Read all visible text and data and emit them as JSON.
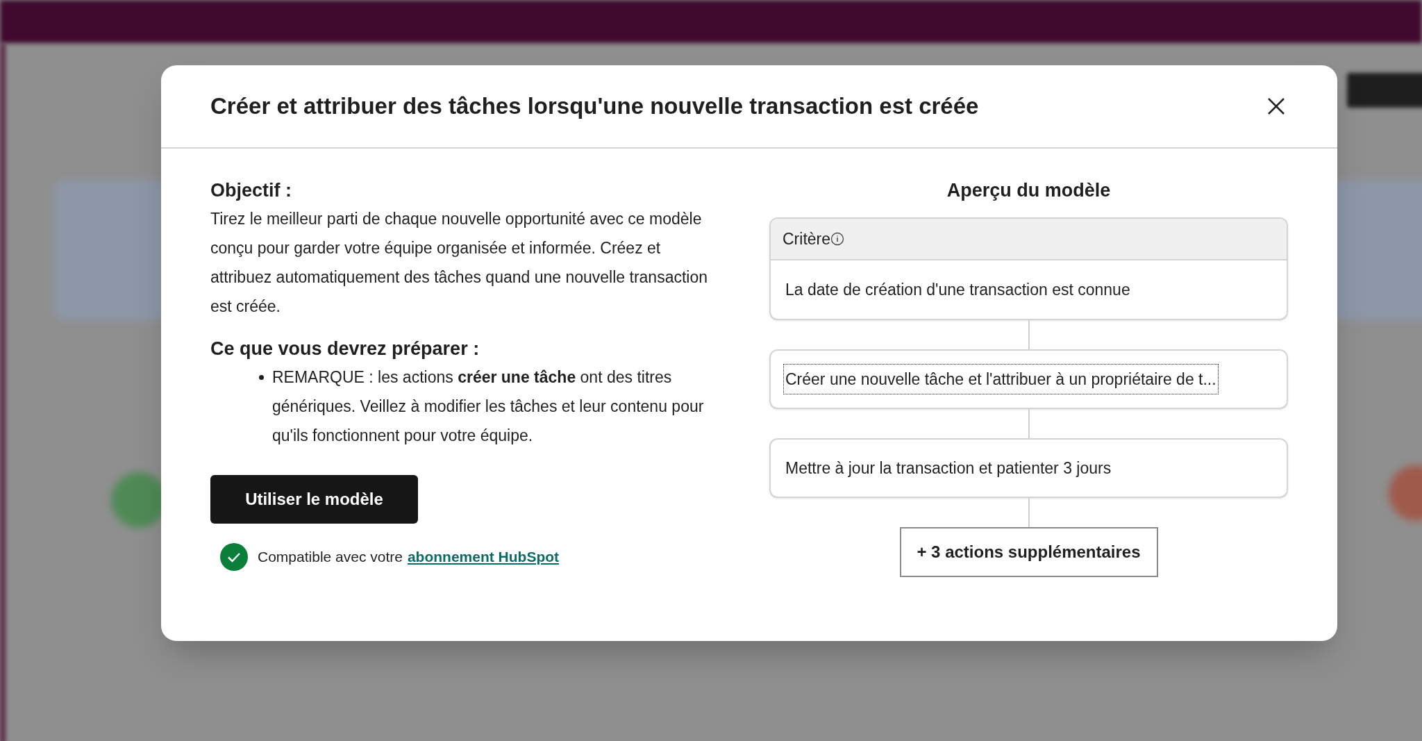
{
  "dialog": {
    "title": "Créer et attribuer des tâches lorsqu'une nouvelle transaction est créée",
    "objective": {
      "heading": "Objectif :",
      "text": "Tirez le meilleur parti de chaque nouvelle opportunité avec ce modèle conçu pour garder votre équipe organisée et informée. Créez et attribuez automatiquement des tâches quand une nouvelle transaction est créée."
    },
    "preparation": {
      "heading": "Ce que vous devrez préparer :",
      "bullets": [
        "REMARQUE : les actions **créer une tâche** ont des titres génériques. Veillez à modifier les tâches et leur contenu pour qu'ils fonctionnent pour votre équipe."
      ]
    },
    "primary_button": "Utiliser le modèle",
    "compatibility": {
      "text": "Compatible avec votre",
      "link": "abonnement HubSpot"
    },
    "preview": {
      "title": "Aperçu du modèle",
      "criteria": {
        "label": "Critère",
        "text": "La date de création d'une transaction est connue"
      },
      "actions": [
        {
          "text": "Créer une nouvelle tâche et l'attribuer à un propriétaire de t...",
          "focused": true
        },
        {
          "text": "Mettre à jour la transaction et patienter 3 jours",
          "focused": false
        }
      ],
      "more_button": "+ 3 actions supplémentaires"
    }
  }
}
